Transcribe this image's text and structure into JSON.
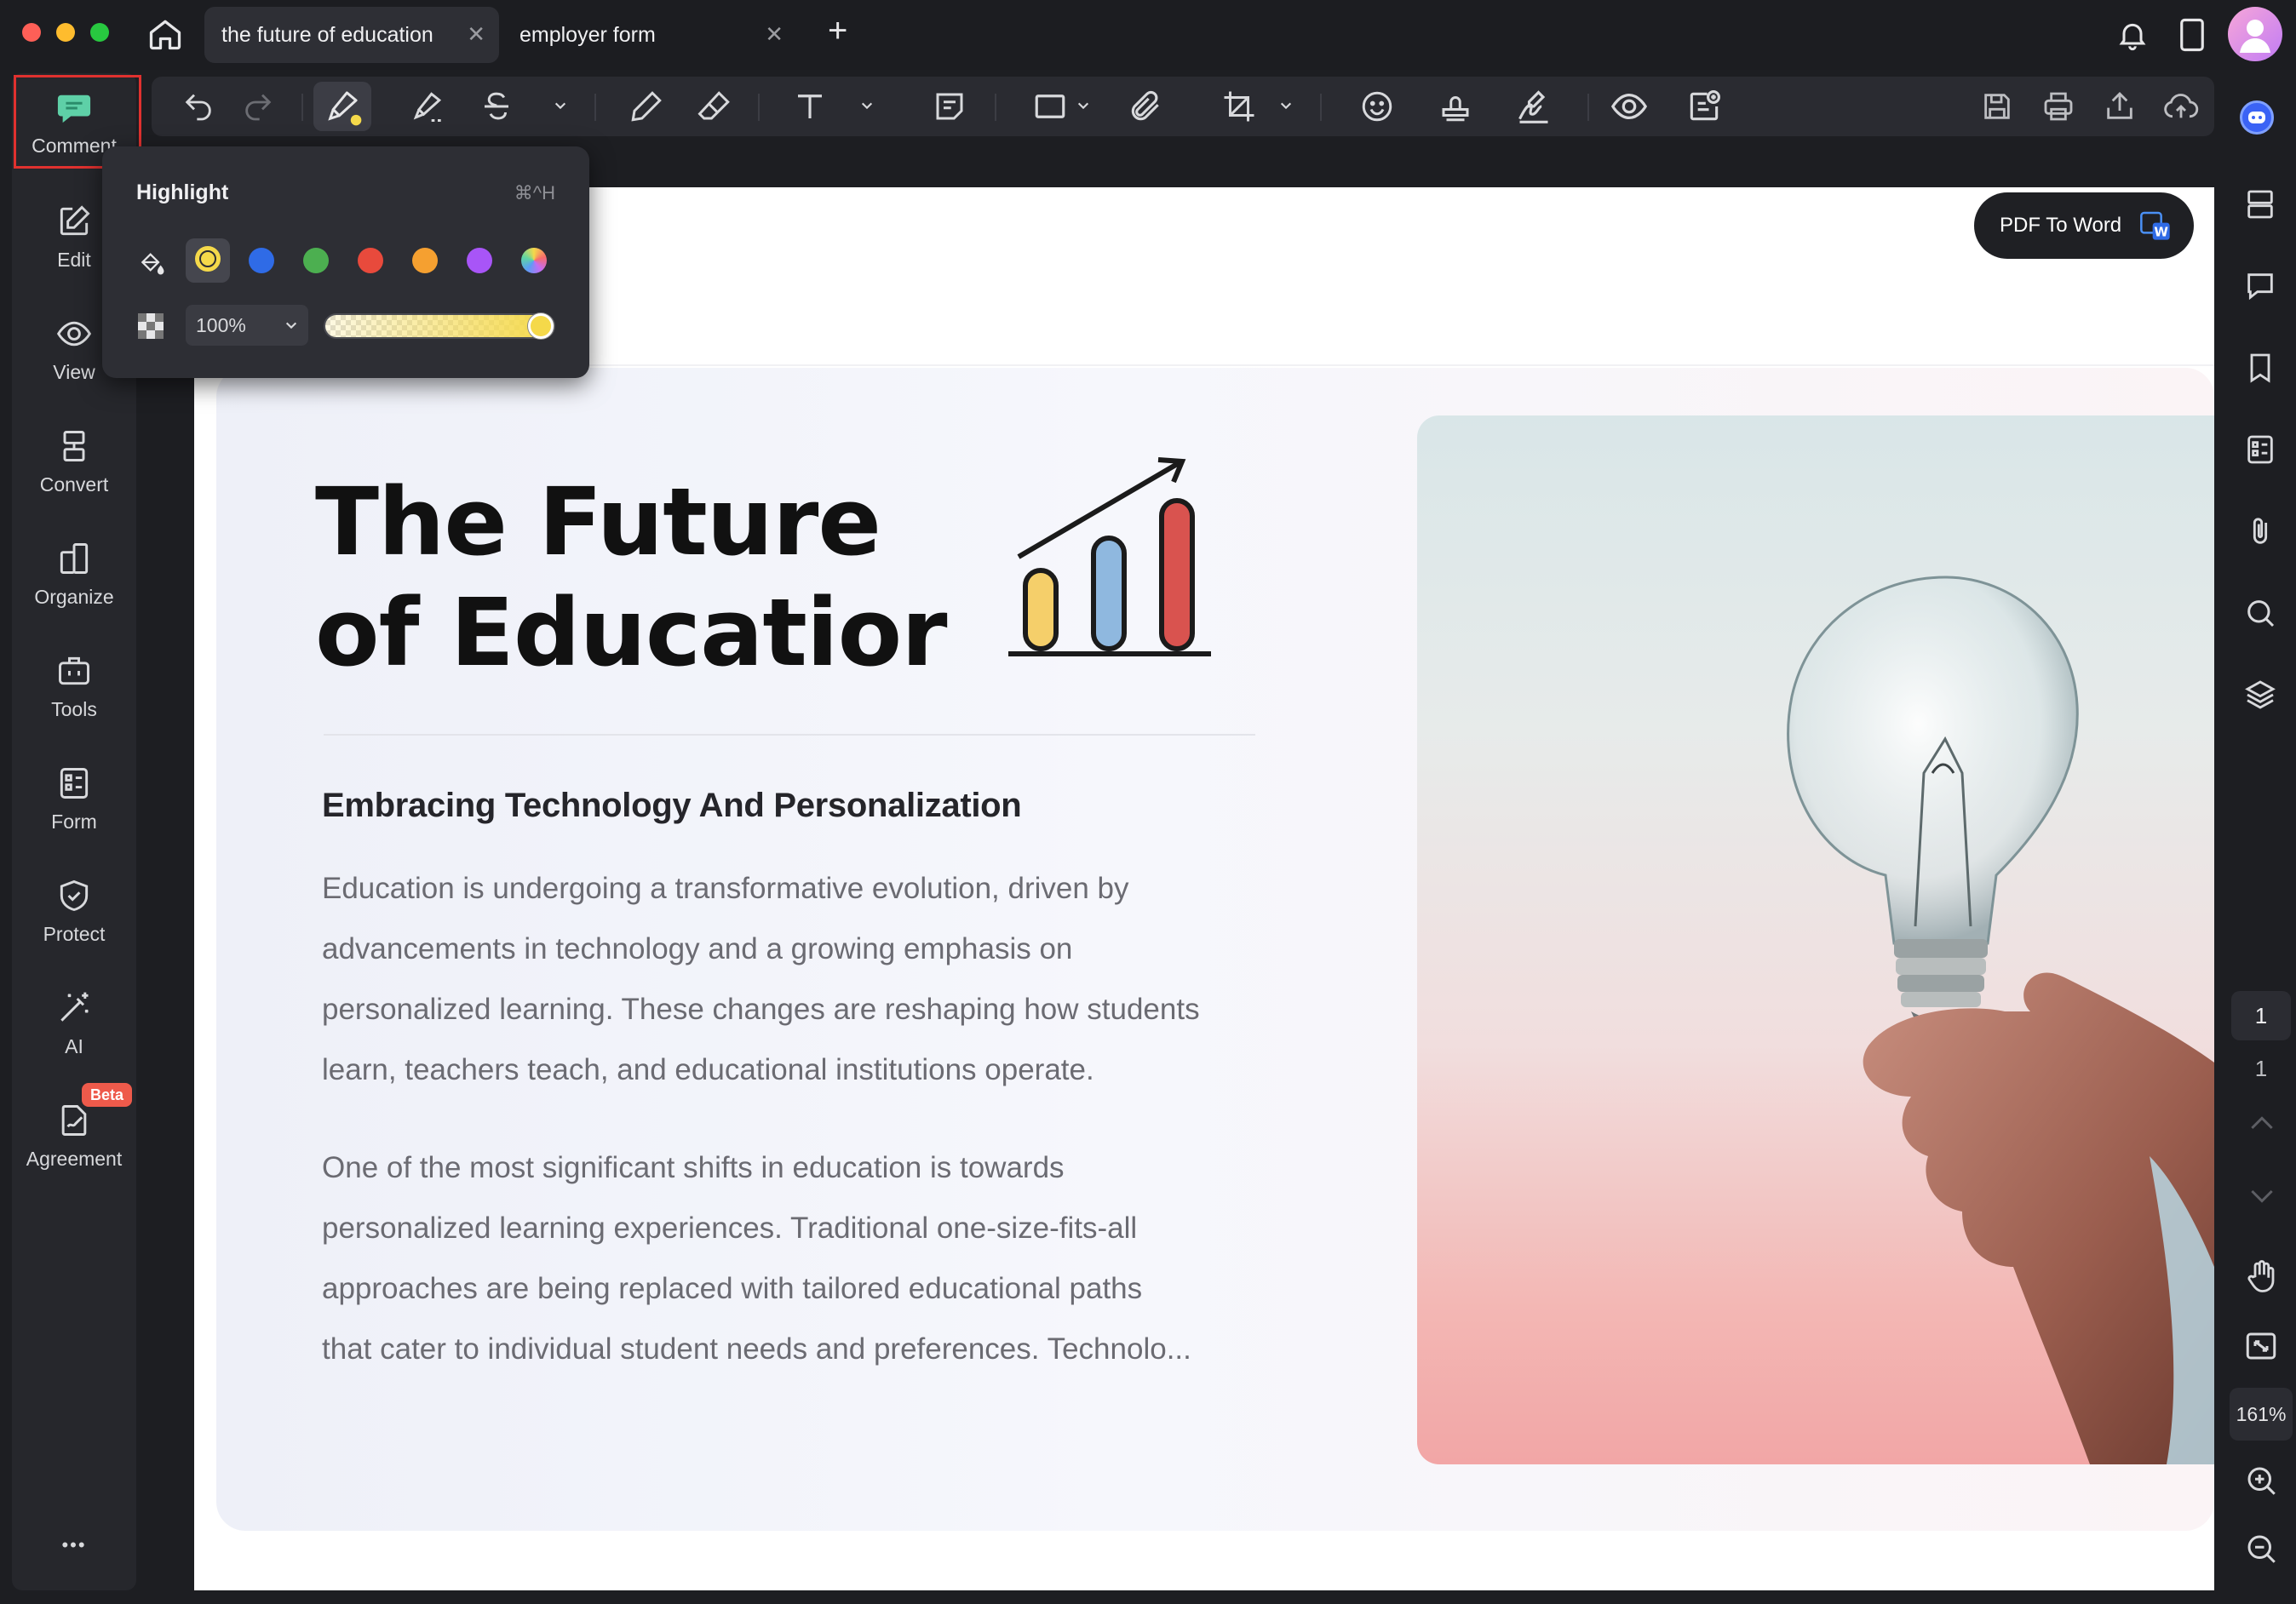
{
  "window": {
    "tabs": [
      {
        "label": "the future of education",
        "active": true
      },
      {
        "label": "employer form",
        "active": false
      }
    ],
    "new_tab": "+"
  },
  "sidebar": {
    "items": [
      {
        "label": "Comment",
        "icon": "comment-icon",
        "active": true
      },
      {
        "label": "Edit",
        "icon": "edit-icon"
      },
      {
        "label": "View",
        "icon": "eye-icon"
      },
      {
        "label": "Convert",
        "icon": "convert-icon"
      },
      {
        "label": "Organize",
        "icon": "organize-icon"
      },
      {
        "label": "Tools",
        "icon": "toolbox-icon"
      },
      {
        "label": "Form",
        "icon": "form-icon"
      },
      {
        "label": "Protect",
        "icon": "shield-icon"
      },
      {
        "label": "AI",
        "icon": "magic-wand-icon"
      },
      {
        "label": "Agreement",
        "icon": "agreement-icon",
        "badge": "Beta"
      }
    ],
    "more": "•••"
  },
  "highlight_popover": {
    "title": "Highlight",
    "shortcut": "⌘^H",
    "colors": [
      "#f5d94a",
      "#2f6be6",
      "#4caf50",
      "#e84a3c",
      "#f5a030",
      "#a855f7",
      "rainbow"
    ],
    "selected_color": "#f5d94a",
    "opacity_value": "100%",
    "opacity_level": 1.0
  },
  "document": {
    "pdf_to_word_label": "PDF To Word",
    "title_line1": "The Future",
    "title_line2": "of Educatior",
    "subtitle": "Embracing Technology And Personalization",
    "paragraph1": [
      "Education is undergoing a transformative evolution, driven by",
      "advancements in technology and a growing emphasis on",
      "personalized learning. These changes are reshaping how students",
      "learn, teachers teach, and educational institutions operate."
    ],
    "paragraph2": [
      "One of the most significant shifts in education is towards",
      "personalized learning experiences. Traditional one-size-fits-all",
      "approaches are being replaced with tailored educational paths",
      "that cater to individual student needs and preferences. Technolo..."
    ]
  },
  "right_panel": {
    "current_page": "1",
    "total_pages": "1",
    "zoom": "161%"
  },
  "colors": {
    "accent_highlight": "#f5d94a",
    "selection_outline": "#e0312f",
    "beta_badge": "#ee5a4b"
  }
}
